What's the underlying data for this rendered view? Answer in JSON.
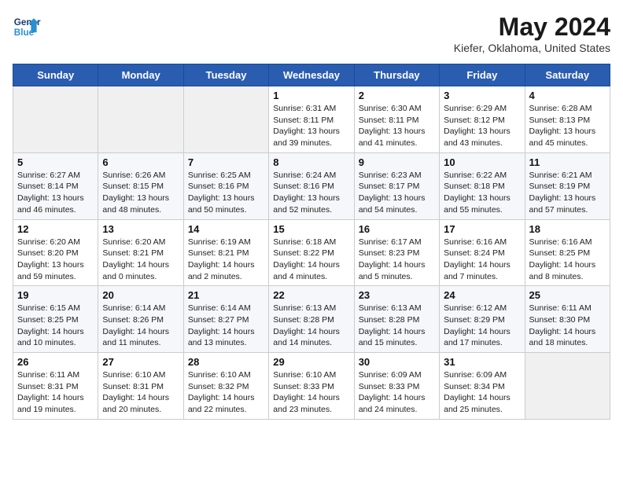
{
  "header": {
    "logo_line1": "General",
    "logo_line2": "Blue",
    "month_year": "May 2024",
    "location": "Kiefer, Oklahoma, United States"
  },
  "weekdays": [
    "Sunday",
    "Monday",
    "Tuesday",
    "Wednesday",
    "Thursday",
    "Friday",
    "Saturday"
  ],
  "weeks": [
    [
      {
        "day": "",
        "info": ""
      },
      {
        "day": "",
        "info": ""
      },
      {
        "day": "",
        "info": ""
      },
      {
        "day": "1",
        "info": "Sunrise: 6:31 AM\nSunset: 8:11 PM\nDaylight: 13 hours\nand 39 minutes."
      },
      {
        "day": "2",
        "info": "Sunrise: 6:30 AM\nSunset: 8:11 PM\nDaylight: 13 hours\nand 41 minutes."
      },
      {
        "day": "3",
        "info": "Sunrise: 6:29 AM\nSunset: 8:12 PM\nDaylight: 13 hours\nand 43 minutes."
      },
      {
        "day": "4",
        "info": "Sunrise: 6:28 AM\nSunset: 8:13 PM\nDaylight: 13 hours\nand 45 minutes."
      }
    ],
    [
      {
        "day": "5",
        "info": "Sunrise: 6:27 AM\nSunset: 8:14 PM\nDaylight: 13 hours\nand 46 minutes."
      },
      {
        "day": "6",
        "info": "Sunrise: 6:26 AM\nSunset: 8:15 PM\nDaylight: 13 hours\nand 48 minutes."
      },
      {
        "day": "7",
        "info": "Sunrise: 6:25 AM\nSunset: 8:16 PM\nDaylight: 13 hours\nand 50 minutes."
      },
      {
        "day": "8",
        "info": "Sunrise: 6:24 AM\nSunset: 8:16 PM\nDaylight: 13 hours\nand 52 minutes."
      },
      {
        "day": "9",
        "info": "Sunrise: 6:23 AM\nSunset: 8:17 PM\nDaylight: 13 hours\nand 54 minutes."
      },
      {
        "day": "10",
        "info": "Sunrise: 6:22 AM\nSunset: 8:18 PM\nDaylight: 13 hours\nand 55 minutes."
      },
      {
        "day": "11",
        "info": "Sunrise: 6:21 AM\nSunset: 8:19 PM\nDaylight: 13 hours\nand 57 minutes."
      }
    ],
    [
      {
        "day": "12",
        "info": "Sunrise: 6:20 AM\nSunset: 8:20 PM\nDaylight: 13 hours\nand 59 minutes."
      },
      {
        "day": "13",
        "info": "Sunrise: 6:20 AM\nSunset: 8:21 PM\nDaylight: 14 hours\nand 0 minutes."
      },
      {
        "day": "14",
        "info": "Sunrise: 6:19 AM\nSunset: 8:21 PM\nDaylight: 14 hours\nand 2 minutes."
      },
      {
        "day": "15",
        "info": "Sunrise: 6:18 AM\nSunset: 8:22 PM\nDaylight: 14 hours\nand 4 minutes."
      },
      {
        "day": "16",
        "info": "Sunrise: 6:17 AM\nSunset: 8:23 PM\nDaylight: 14 hours\nand 5 minutes."
      },
      {
        "day": "17",
        "info": "Sunrise: 6:16 AM\nSunset: 8:24 PM\nDaylight: 14 hours\nand 7 minutes."
      },
      {
        "day": "18",
        "info": "Sunrise: 6:16 AM\nSunset: 8:25 PM\nDaylight: 14 hours\nand 8 minutes."
      }
    ],
    [
      {
        "day": "19",
        "info": "Sunrise: 6:15 AM\nSunset: 8:25 PM\nDaylight: 14 hours\nand 10 minutes."
      },
      {
        "day": "20",
        "info": "Sunrise: 6:14 AM\nSunset: 8:26 PM\nDaylight: 14 hours\nand 11 minutes."
      },
      {
        "day": "21",
        "info": "Sunrise: 6:14 AM\nSunset: 8:27 PM\nDaylight: 14 hours\nand 13 minutes."
      },
      {
        "day": "22",
        "info": "Sunrise: 6:13 AM\nSunset: 8:28 PM\nDaylight: 14 hours\nand 14 minutes."
      },
      {
        "day": "23",
        "info": "Sunrise: 6:13 AM\nSunset: 8:28 PM\nDaylight: 14 hours\nand 15 minutes."
      },
      {
        "day": "24",
        "info": "Sunrise: 6:12 AM\nSunset: 8:29 PM\nDaylight: 14 hours\nand 17 minutes."
      },
      {
        "day": "25",
        "info": "Sunrise: 6:11 AM\nSunset: 8:30 PM\nDaylight: 14 hours\nand 18 minutes."
      }
    ],
    [
      {
        "day": "26",
        "info": "Sunrise: 6:11 AM\nSunset: 8:31 PM\nDaylight: 14 hours\nand 19 minutes."
      },
      {
        "day": "27",
        "info": "Sunrise: 6:10 AM\nSunset: 8:31 PM\nDaylight: 14 hours\nand 20 minutes."
      },
      {
        "day": "28",
        "info": "Sunrise: 6:10 AM\nSunset: 8:32 PM\nDaylight: 14 hours\nand 22 minutes."
      },
      {
        "day": "29",
        "info": "Sunrise: 6:10 AM\nSunset: 8:33 PM\nDaylight: 14 hours\nand 23 minutes."
      },
      {
        "day": "30",
        "info": "Sunrise: 6:09 AM\nSunset: 8:33 PM\nDaylight: 14 hours\nand 24 minutes."
      },
      {
        "day": "31",
        "info": "Sunrise: 6:09 AM\nSunset: 8:34 PM\nDaylight: 14 hours\nand 25 minutes."
      },
      {
        "day": "",
        "info": ""
      }
    ]
  ]
}
